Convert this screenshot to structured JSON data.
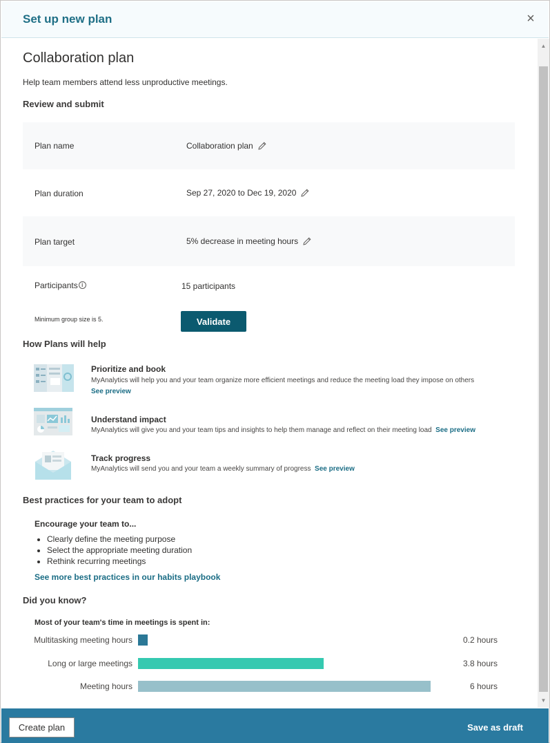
{
  "header": {
    "title": "Set up new plan"
  },
  "plan": {
    "title": "Collaboration plan",
    "description": "Help team members attend less unproductive meetings."
  },
  "review": {
    "heading": "Review and submit",
    "rows": [
      {
        "label": "Plan name",
        "value": "Collaboration plan"
      },
      {
        "label": "Plan duration",
        "value": "Sep 27, 2020 to Dec 19, 2020"
      },
      {
        "label": "Plan target",
        "value": "5% decrease in meeting hours"
      }
    ],
    "participants_label": "Participants",
    "participants_value": "15 participants",
    "min_group_note": "Minimum group size is 5.",
    "validate_label": "Validate"
  },
  "help": {
    "heading": "How Plans will help",
    "items": [
      {
        "title": "Prioritize and book",
        "desc": "MyAnalytics will help you and your team organize more efficient meetings and reduce the meeting load they impose on others",
        "link": "See preview"
      },
      {
        "title": "Understand impact",
        "desc": "MyAnalytics will give you and your team tips and insights to help them manage and reflect on their meeting load",
        "link": "See preview"
      },
      {
        "title": "Track progress",
        "desc": "MyAnalytics will send you and your team a weekly summary of progress",
        "link": "See preview"
      }
    ]
  },
  "practices": {
    "heading": "Best practices for your team to adopt",
    "intro": "Encourage your team to...",
    "bullets": [
      "Clearly define the meeting purpose",
      "Select the appropriate meeting duration",
      "Rethink recurring meetings"
    ],
    "link": "See more best practices in our habits playbook"
  },
  "did_you_know": {
    "heading": "Did you know?",
    "subheading": "Most of your team's time in meetings is spent in:"
  },
  "chart_data": {
    "type": "bar",
    "orientation": "horizontal",
    "categories": [
      "Multitasking meeting hours",
      "Long or large meetings",
      "Meeting hours"
    ],
    "values": [
      0.2,
      3.8,
      6
    ],
    "value_labels": [
      "0.2 hours",
      "3.8 hours",
      "6 hours"
    ],
    "colors": [
      "#2b7896",
      "#35c9b0",
      "#97c0ca"
    ],
    "xlim": [
      0,
      6
    ]
  },
  "footer": {
    "create_label": "Create plan",
    "draft_label": "Save as draft"
  },
  "colors": {
    "accent": "#2a7aa0",
    "title": "#1f6f86",
    "button": "#0b5a6f",
    "link": "#1b6d85"
  }
}
